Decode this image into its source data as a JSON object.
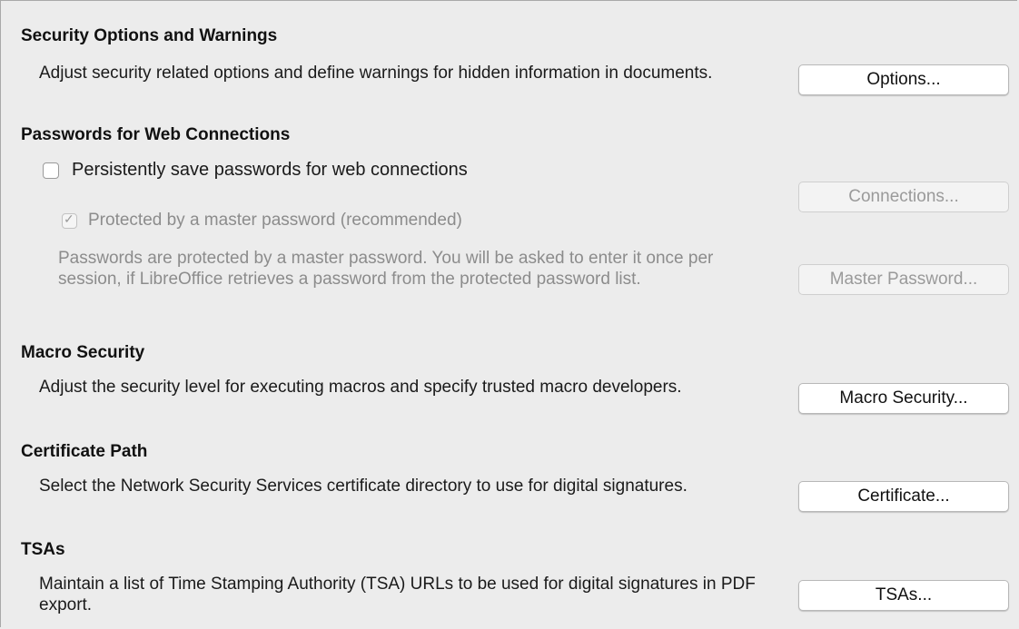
{
  "sections": {
    "security_options": {
      "heading": "Security Options and Warnings",
      "description": "Adjust security related options and define warnings for hidden information in documents.",
      "button": "Options..."
    },
    "passwords": {
      "heading": "Passwords for Web Connections",
      "persist_label": "Persistently save passwords for web connections",
      "persist_checked": false,
      "master_label": "Protected by a master password (recommended)",
      "master_checked": true,
      "connections_button": "Connections...",
      "description": "Passwords are protected by a master password. You will be asked to enter it once per session, if LibreOffice retrieves a password from the protected password list.",
      "master_button": "Master Password..."
    },
    "macro_security": {
      "heading": "Macro Security",
      "description": "Adjust the security level for executing macros and specify trusted macro developers.",
      "button": "Macro Security..."
    },
    "certificate_path": {
      "heading": "Certificate Path",
      "description": "Select the Network Security Services certificate directory to use for digital signatures.",
      "button": "Certificate..."
    },
    "tsas": {
      "heading": "TSAs",
      "description": "Maintain a list of Time Stamping Authority (TSA) URLs to be used for digital signatures in PDF export.",
      "button": "TSAs..."
    }
  },
  "icons": {
    "check_glyph": "✓"
  },
  "colors": {
    "background": "#ececec",
    "disabled_text": "#8c8c8c"
  }
}
